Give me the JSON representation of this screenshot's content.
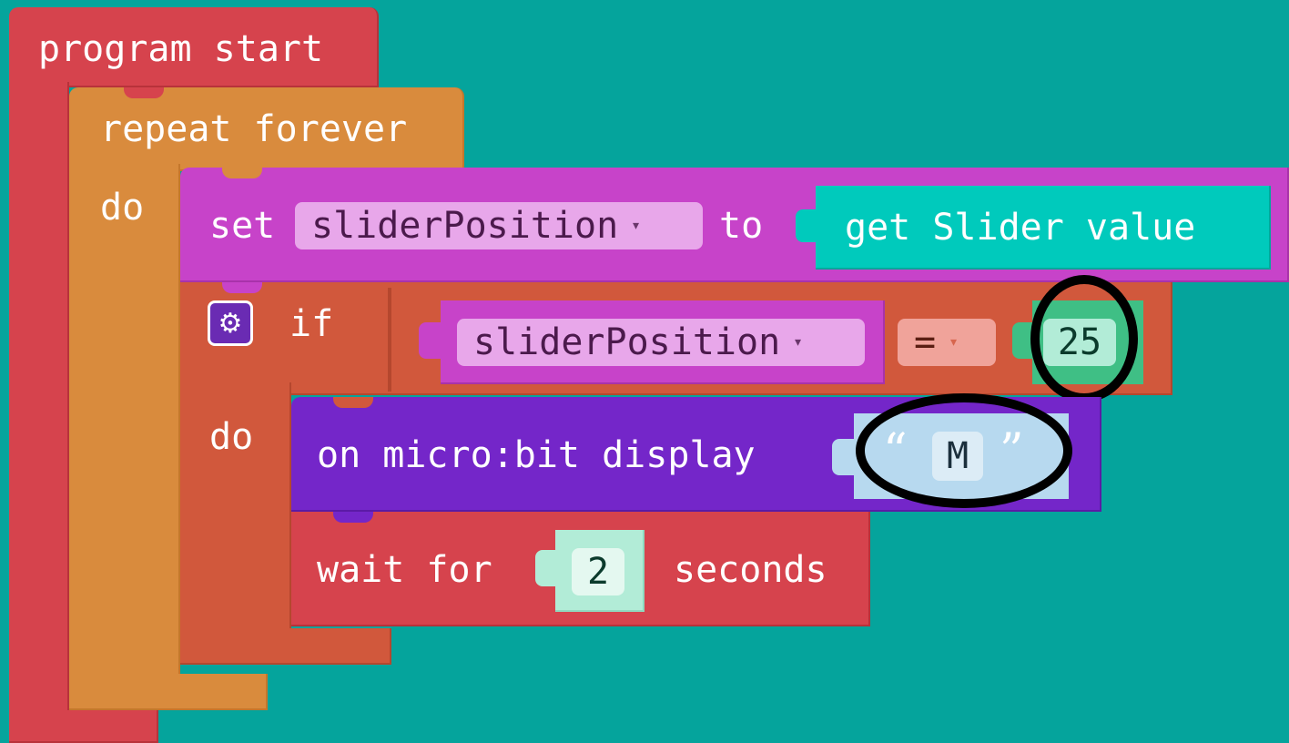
{
  "program": {
    "start_label": "program start",
    "repeat_label": "repeat forever",
    "do_label": "do"
  },
  "set_block": {
    "set_label": "set",
    "variable": "sliderPosition",
    "to_label": "to",
    "value_block": "get Slider value"
  },
  "if_block": {
    "if_label": "if",
    "do_label": "do",
    "left_variable": "sliderPosition",
    "operator": "=",
    "right_value": "25"
  },
  "display_block": {
    "label": "on micro:bit display",
    "open_quote": "“",
    "text": "M",
    "close_quote": "”"
  },
  "wait_block": {
    "wait_label": "wait for",
    "value": "2",
    "unit_label": "seconds"
  },
  "icons": {
    "dropdown": "▾",
    "gear": "⚙"
  },
  "colors": {
    "workspace": "#05a49c",
    "program_start": "#d6434d",
    "repeat": "#d98b3d",
    "set": "#c743c9",
    "get_slider": "#00cabc",
    "if": "#d1583c",
    "display": "#7426c9",
    "wait": "#d6434d",
    "number": "#b2ecd7",
    "text_value": "#b7d9ef",
    "highlight_ring": "#000000"
  }
}
